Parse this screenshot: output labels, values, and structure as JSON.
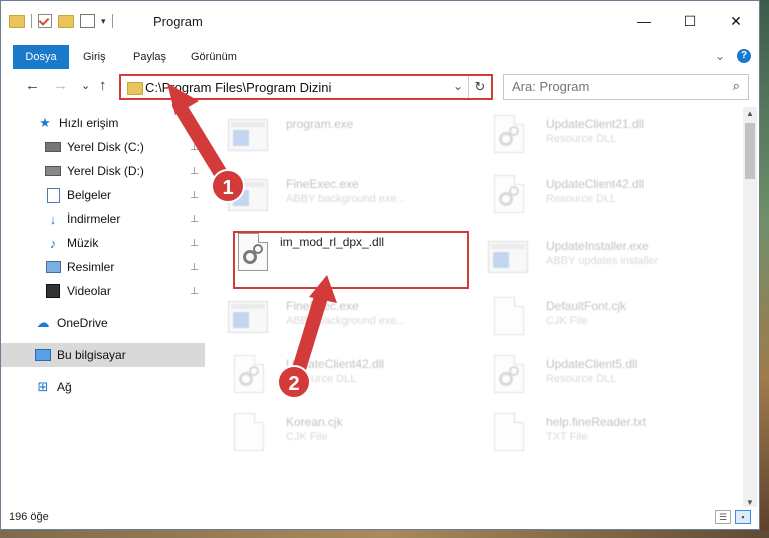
{
  "window": {
    "title": "Program",
    "qat_dropdown": "▾",
    "controls": {
      "minimize": "—",
      "maximize": "☐",
      "close": "✕"
    }
  },
  "ribbon": {
    "tabs": [
      "Dosya",
      "Giriş",
      "Paylaş",
      "Görünüm"
    ],
    "expand": "⌄",
    "help": "?"
  },
  "nav": {
    "back": "←",
    "forward": "→",
    "recent": "⌄",
    "up": "↑",
    "address": "C:\\Program Files\\Program Dizini",
    "address_dropdown": "⌄",
    "refresh": "↻",
    "search_placeholder": "Ara: Program",
    "search_icon": "⌕"
  },
  "sidebar": {
    "items": [
      {
        "label": "Hızlı erişim",
        "icon": "star-icon",
        "pinned": false
      },
      {
        "label": "Yerel Disk (C:)",
        "icon": "drive-icon",
        "pinned": true
      },
      {
        "label": "Yerel Disk (D:)",
        "icon": "drive-icon",
        "pinned": true
      },
      {
        "label": "Belgeler",
        "icon": "documents-icon",
        "pinned": true
      },
      {
        "label": "İndirmeler",
        "icon": "download-icon",
        "pinned": true
      },
      {
        "label": "Müzik",
        "icon": "music-icon",
        "pinned": true
      },
      {
        "label": "Resimler",
        "icon": "pictures-icon",
        "pinned": true
      },
      {
        "label": "Videolar",
        "icon": "videos-icon",
        "pinned": true
      },
      {
        "label": "OneDrive",
        "icon": "cloud-icon",
        "pinned": false
      },
      {
        "label": "Bu bilgisayar",
        "icon": "computer-icon",
        "pinned": false
      },
      {
        "label": "Ağ",
        "icon": "network-icon",
        "pinned": false
      }
    ],
    "pin_glyph": "📌"
  },
  "files": [
    {
      "name": "program.exe",
      "type": "",
      "icon": "exe-icon",
      "faded": true
    },
    {
      "name": "UpdateClient21.dll",
      "type": "Resource DLL",
      "icon": "dll-icon",
      "faded": true
    },
    {
      "name": "FineExec.exe",
      "type": "ABBY background exe...",
      "icon": "app-icon",
      "faded": true
    },
    {
      "name": "UpdateClient42.dll",
      "type": "Resource DLL",
      "icon": "dll-icon",
      "faded": true
    },
    {
      "name": "im_mod_rl_dpx_.dll",
      "type": "",
      "icon": "dll-icon",
      "faded": false
    },
    {
      "name": "UpdateInstaller.exe",
      "type": "ABBY updates installer",
      "icon": "app-icon",
      "faded": true
    },
    {
      "name": "FineExec.exe",
      "type": "ABBY background exe...",
      "icon": "app-icon",
      "faded": true
    },
    {
      "name": "DefaultFont.cjk",
      "type": "CJK File",
      "icon": "doc-icon",
      "faded": true
    },
    {
      "name": "UpdateClient42.dll",
      "type": "Resource DLL",
      "icon": "dll-icon",
      "faded": true
    },
    {
      "name": "UpdateClient5.dll",
      "type": "Resource DLL",
      "icon": "dll-icon",
      "faded": true
    },
    {
      "name": "Korean.cjk",
      "type": "CJK File",
      "icon": "doc-icon",
      "faded": true
    },
    {
      "name": "help.fineReader.txt",
      "type": "TXT File",
      "icon": "doc-icon",
      "faded": true
    }
  ],
  "status": {
    "count": "196 öğe"
  },
  "annotations": {
    "step1": "1",
    "step2": "2",
    "color": "#d33a3a"
  }
}
